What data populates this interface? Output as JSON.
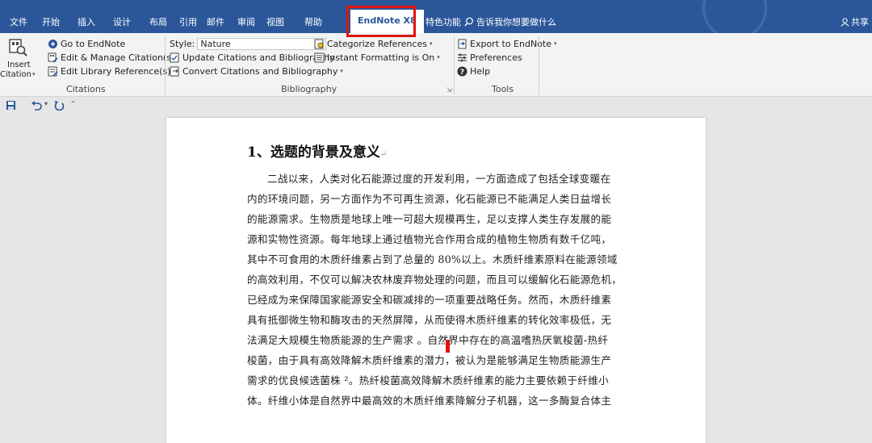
{
  "tabs": [
    {
      "label": "文件"
    },
    {
      "label": "开始"
    },
    {
      "label": "插入"
    },
    {
      "label": "设计"
    },
    {
      "label": "布局"
    },
    {
      "label": "引用"
    },
    {
      "label": "邮件"
    },
    {
      "label": "审阅"
    },
    {
      "label": "视图"
    },
    {
      "label": "帮助"
    },
    {
      "label": "EndNote X8"
    },
    {
      "label": "特色功能"
    }
  ],
  "tell_me": "告诉我你想要做什么",
  "share": "共享",
  "colors": {
    "ribbon_blue": "#2b579a",
    "highlight_red": "#e0140f"
  },
  "ribbon": {
    "citations": {
      "insert_label_1": "Insert",
      "insert_label_2": "Citation",
      "go_to_endnote": "Go to EndNote",
      "edit_manage": "Edit & Manage Citation(s)",
      "edit_library": "Edit Library Reference(s)",
      "group": "Citations"
    },
    "bibliography": {
      "style_label": "Style:",
      "style_value": "Nature",
      "update": "Update Citations and Bibliography",
      "convert": "Convert Citations and Bibliography",
      "categorize": "Categorize References",
      "instant": "Instant Formatting is On",
      "group": "Bibliography"
    },
    "tools": {
      "export": "Export to EndNote",
      "preferences": "Preferences",
      "help": "Help",
      "group": "Tools"
    }
  },
  "document": {
    "heading": "1、选题的背景及意义",
    "lines": [
      "二战以来，人类对化石能源过度的开发利用，一方面造成了包括全球变暖在",
      "内的环境问题，另一方面作为不可再生资源，化石能源已不能满足人类日益增长",
      "的能源需求。生物质是地球上唯一可超大规模再生，足以支撑人类生存发展的能",
      "源和实物性资源。每年地球上通过植物光合作用合成的植物生物质有数千亿吨，",
      "其中不可食用的木质纤维素占到了总量的 80%以上。木质纤维素原料在能源领域",
      "的高效利用，不仅可以解决农林废弃物处理的问题，而且可以缓解化石能源危机，",
      "已经成为来保障国家能源安全和碳减排的一项重要战略任务。然而，木质纤维素",
      "具有抵御微生物和酶攻击的天然屏障，从而使得木质纤维素的转化效率极低，无",
      "法满足大规模生物质能源的生产需求   。自然界中存在的高温嗜热厌氧梭菌-热纤",
      "梭菌，由于具有高效降解木质纤维素的潜力，被认为是能够满足生物质能源生产",
      "需求的优良候选菌株 ²。热纤梭菌高效降解木质纤维素的能力主要依赖于纤维小",
      "体。纤维小体是自然界中最高效的木质纤维素降解分子机器，这一多酶复合体主"
    ]
  }
}
